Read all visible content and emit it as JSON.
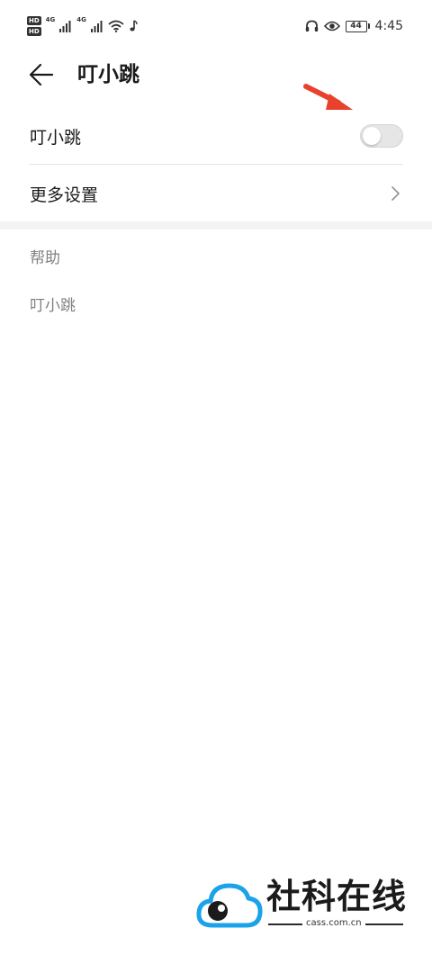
{
  "status_bar": {
    "hd_badge_1": "HD",
    "hd_badge_2": "HD",
    "network_1": "4G",
    "network_2": "4G",
    "battery_level": "44",
    "time": "4:45",
    "icons": [
      "signal-icon",
      "wifi-icon",
      "music-note-icon",
      "headphones-icon",
      "eye-comfort-icon",
      "battery-icon"
    ]
  },
  "app_bar": {
    "title": "叮小跳"
  },
  "settings": {
    "toggle_row": {
      "label": "叮小跳",
      "enabled": false
    },
    "more_row": {
      "label": "更多设置"
    }
  },
  "help": {
    "header": "帮助",
    "items": [
      "叮小跳"
    ]
  },
  "watermark": {
    "text": "社科在线",
    "url": "cass.com.cn"
  },
  "colors": {
    "annotation_arrow": "#e8412c",
    "toggle_off": "#e6e6e6",
    "secondary_text": "#808080",
    "logo_blue": "#1aa3e8"
  }
}
